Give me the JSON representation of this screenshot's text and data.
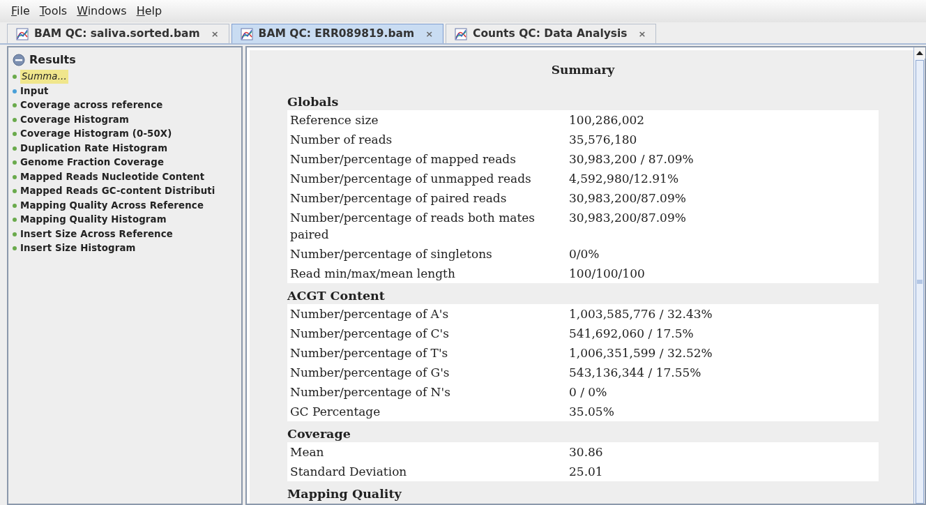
{
  "menu": [
    "File",
    "Tools",
    "Windows",
    "Help"
  ],
  "tabs": [
    {
      "label": "BAM QC: saliva.sorted.bam",
      "selected": false,
      "close": "×"
    },
    {
      "label": "BAM QC: ERR089819.bam",
      "selected": true,
      "close": "×"
    },
    {
      "label": "Counts QC: Data Analysis",
      "selected": false,
      "close": "×"
    }
  ],
  "sidebar": {
    "title": "Results",
    "items": [
      {
        "label": "Summa...",
        "selected": true,
        "color": "#6aaa4c"
      },
      {
        "label": "Input",
        "selected": false,
        "color": "#4aa0d8"
      },
      {
        "label": "Coverage across reference",
        "selected": false,
        "color": "#6aaa4c"
      },
      {
        "label": "Coverage Histogram",
        "selected": false,
        "color": "#6aaa4c"
      },
      {
        "label": "Coverage Histogram (0-50X)",
        "selected": false,
        "color": "#6aaa4c"
      },
      {
        "label": "Duplication Rate Histogram",
        "selected": false,
        "color": "#6aaa4c"
      },
      {
        "label": "Genome Fraction Coverage",
        "selected": false,
        "color": "#6aaa4c"
      },
      {
        "label": "Mapped Reads Nucleotide Content",
        "selected": false,
        "color": "#6aaa4c"
      },
      {
        "label": "Mapped Reads GC-content Distributi",
        "selected": false,
        "color": "#6aaa4c"
      },
      {
        "label": "Mapping Quality Across Reference",
        "selected": false,
        "color": "#6aaa4c"
      },
      {
        "label": "Mapping Quality Histogram",
        "selected": false,
        "color": "#6aaa4c"
      },
      {
        "label": "Insert Size Across Reference",
        "selected": false,
        "color": "#6aaa4c"
      },
      {
        "label": "Insert Size Histogram",
        "selected": false,
        "color": "#6aaa4c"
      }
    ]
  },
  "summary": {
    "title": "Summary",
    "sections": [
      {
        "heading": "Globals",
        "rows": [
          [
            "Reference size",
            "100,286,002"
          ],
          [
            "Number of reads",
            "35,576,180"
          ],
          [
            "Number/percentage of mapped reads",
            "30,983,200 / 87.09%"
          ],
          [
            "Number/percentage of unmapped reads",
            "4,592,980/12.91%"
          ],
          [
            "Number/percentage of paired reads",
            "30,983,200/87.09%"
          ],
          [
            "Number/percentage of reads both mates paired",
            "30,983,200/87.09%"
          ],
          [
            "Number/percentage of singletons",
            "0/0%"
          ],
          [
            "Read min/max/mean length",
            "100/100/100"
          ]
        ]
      },
      {
        "heading": "ACGT Content",
        "rows": [
          [
            "Number/percentage of A's",
            "1,003,585,776 / 32.43%"
          ],
          [
            "Number/percentage of C's",
            "541,692,060 / 17.5%"
          ],
          [
            "Number/percentage of T's",
            "1,006,351,599 / 32.52%"
          ],
          [
            "Number/percentage of G's",
            "543,136,344 / 17.55%"
          ],
          [
            "Number/percentage of N's",
            "0 / 0%"
          ],
          [
            "GC Percentage",
            "35.05%"
          ]
        ]
      },
      {
        "heading": "Coverage",
        "rows": [
          [
            "Mean",
            "30.86"
          ],
          [
            "Standard Deviation",
            "25.01"
          ]
        ]
      },
      {
        "heading": "Mapping Quality"
      }
    ]
  }
}
